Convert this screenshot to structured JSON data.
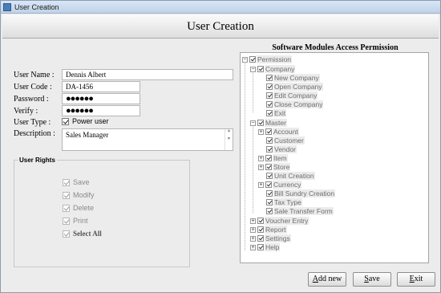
{
  "window": {
    "title": "User Creation"
  },
  "header": {
    "title": "User Creation"
  },
  "form": {
    "user_name_label": "User Name :",
    "user_name": "Dennis Albert",
    "user_code_label": "User Code :",
    "user_code": "DA-1456",
    "password_label": "Password :",
    "password": "●●●●●●",
    "verify_label": "Verify :",
    "verify": "●●●●●●",
    "user_type_label": "User Type :",
    "user_type_option": "Power user",
    "description_label": "Description :",
    "description": "Sales Manager"
  },
  "rights": {
    "title": "User Rights",
    "items": [
      "Save",
      "Modify",
      "Delete",
      "Print"
    ],
    "select_all": "Select All"
  },
  "permissions": {
    "title": "Software Modules Access Permission",
    "root": "Permission",
    "company": "Company",
    "company_items": [
      "New Company",
      "Open Company",
      "Edit Company",
      "Close Company",
      "Exit"
    ],
    "master": "Master",
    "master_items": [
      "Account",
      "Customer",
      "Vendor",
      "Item",
      "Store",
      "Unit Creation",
      "Currency",
      "Bill Sundry Creation",
      "Tax Type",
      "Sale Transfer Form"
    ],
    "top_items": [
      "Voucher Entry",
      "Report",
      "Settings",
      "Help"
    ]
  },
  "buttons": {
    "add_new_u": "A",
    "add_new_rest": "dd new",
    "save_u": "S",
    "save_rest": "ave",
    "exit_u": "E",
    "exit_rest": "xit"
  }
}
